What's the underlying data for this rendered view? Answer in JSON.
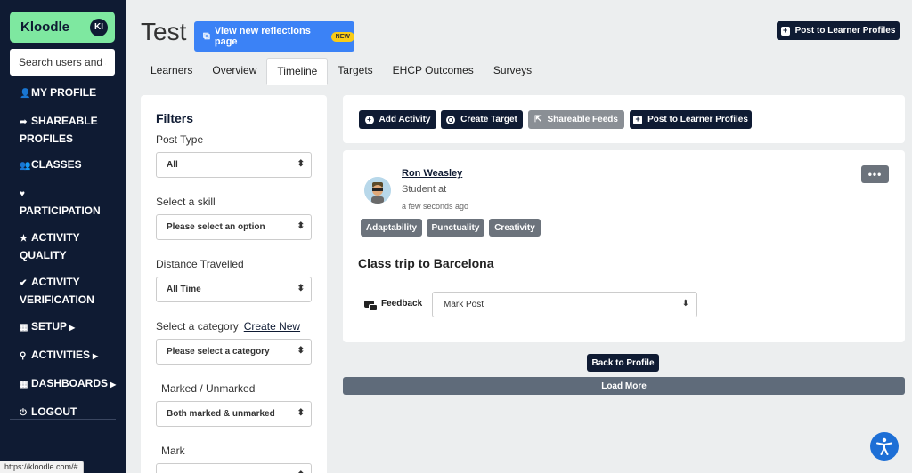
{
  "brand": {
    "name": "Kloodle",
    "badge": "KI"
  },
  "sidebar": {
    "search_placeholder": "Search users and a",
    "items": [
      {
        "label": "MY PROFILE",
        "icon": "user-icon"
      },
      {
        "label": "SHAREABLE PROFILES",
        "icon": "share-icon"
      },
      {
        "label": "CLASSES",
        "icon": "users-icon"
      },
      {
        "label": "PARTICIPATION",
        "icon": "heart-icon"
      },
      {
        "label": "ACTIVITY QUALITY",
        "icon": "star-icon"
      },
      {
        "label": "ACTIVITY VERIFICATION",
        "icon": "check-circle-icon"
      },
      {
        "label": "SETUP",
        "icon": "grid-icon"
      },
      {
        "label": "ACTIVITIES",
        "icon": "link-icon"
      },
      {
        "label": "DASHBOARDS",
        "icon": "grid-icon"
      },
      {
        "label": "LOGOUT",
        "icon": "power-icon"
      }
    ]
  },
  "header": {
    "title": "Test",
    "reflections_button": "View new reflections page",
    "new_badge": "NEW",
    "post_button": "Post to Learner Profiles"
  },
  "tabs": [
    {
      "label": "Learners",
      "active": false
    },
    {
      "label": "Overview",
      "active": false
    },
    {
      "label": "Timeline",
      "active": true
    },
    {
      "label": "Targets",
      "active": false
    },
    {
      "label": "EHCP Outcomes",
      "active": false
    },
    {
      "label": "Surveys",
      "active": false
    }
  ],
  "filters": {
    "title": "Filters",
    "post_type": {
      "label": "Post Type",
      "value": "All"
    },
    "skill": {
      "label": "Select a skill",
      "value": "Please select an option"
    },
    "distance": {
      "label": "Distance Travelled",
      "value": "All Time"
    },
    "category": {
      "label": "Select a category",
      "create_new": "Create New",
      "value": "Please select a category"
    },
    "marked": {
      "label": "Marked / Unmarked",
      "value": "Both marked & unmarked"
    },
    "mark": {
      "label": "Mark"
    }
  },
  "actions": {
    "add_activity": "Add Activity",
    "create_target": "Create Target",
    "shareable_feeds": "Shareable Feeds",
    "post_to_profiles": "Post to Learner Profiles"
  },
  "post": {
    "author": "Ron Weasley",
    "role": "Student at",
    "time": "a few seconds ago",
    "skills": [
      "Adaptability",
      "Punctuality",
      "Creativity"
    ],
    "title": "Class trip to Barcelona",
    "feedback_label": "Feedback",
    "mark_value": "Mark Post",
    "more": "•••"
  },
  "buttons": {
    "back_to_profile": "Back to Profile",
    "load_more": "Load More"
  },
  "status_url": "https://kloodle.com/#",
  "colors": {
    "sidebar": "#0f1b33",
    "brand": "#7ee8a0",
    "accent": "#3b82f6",
    "badge": "#facc15",
    "tag": "#6c737c"
  }
}
